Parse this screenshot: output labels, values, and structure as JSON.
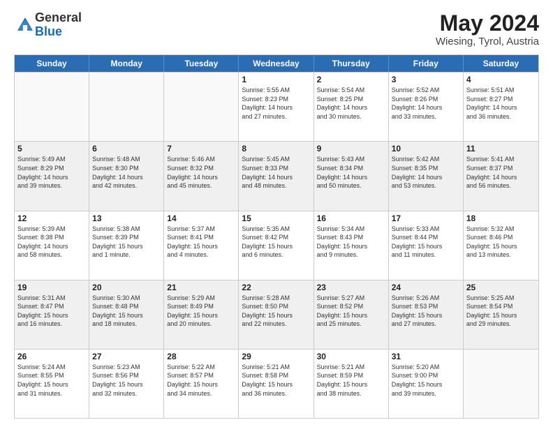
{
  "header": {
    "logo": {
      "line1": "General",
      "line2": "Blue"
    },
    "month": "May 2024",
    "location": "Wiesing, Tyrol, Austria"
  },
  "calendar": {
    "days": [
      "Sunday",
      "Monday",
      "Tuesday",
      "Wednesday",
      "Thursday",
      "Friday",
      "Saturday"
    ],
    "rows": [
      [
        {
          "day": "",
          "info": ""
        },
        {
          "day": "",
          "info": ""
        },
        {
          "day": "",
          "info": ""
        },
        {
          "day": "1",
          "info": "Sunrise: 5:55 AM\nSunset: 8:23 PM\nDaylight: 14 hours\nand 27 minutes."
        },
        {
          "day": "2",
          "info": "Sunrise: 5:54 AM\nSunset: 8:25 PM\nDaylight: 14 hours\nand 30 minutes."
        },
        {
          "day": "3",
          "info": "Sunrise: 5:52 AM\nSunset: 8:26 PM\nDaylight: 14 hours\nand 33 minutes."
        },
        {
          "day": "4",
          "info": "Sunrise: 5:51 AM\nSunset: 8:27 PM\nDaylight: 14 hours\nand 36 minutes."
        }
      ],
      [
        {
          "day": "5",
          "info": "Sunrise: 5:49 AM\nSunset: 8:29 PM\nDaylight: 14 hours\nand 39 minutes."
        },
        {
          "day": "6",
          "info": "Sunrise: 5:48 AM\nSunset: 8:30 PM\nDaylight: 14 hours\nand 42 minutes."
        },
        {
          "day": "7",
          "info": "Sunrise: 5:46 AM\nSunset: 8:32 PM\nDaylight: 14 hours\nand 45 minutes."
        },
        {
          "day": "8",
          "info": "Sunrise: 5:45 AM\nSunset: 8:33 PM\nDaylight: 14 hours\nand 48 minutes."
        },
        {
          "day": "9",
          "info": "Sunrise: 5:43 AM\nSunset: 8:34 PM\nDaylight: 14 hours\nand 50 minutes."
        },
        {
          "day": "10",
          "info": "Sunrise: 5:42 AM\nSunset: 8:35 PM\nDaylight: 14 hours\nand 53 minutes."
        },
        {
          "day": "11",
          "info": "Sunrise: 5:41 AM\nSunset: 8:37 PM\nDaylight: 14 hours\nand 56 minutes."
        }
      ],
      [
        {
          "day": "12",
          "info": "Sunrise: 5:39 AM\nSunset: 8:38 PM\nDaylight: 14 hours\nand 58 minutes."
        },
        {
          "day": "13",
          "info": "Sunrise: 5:38 AM\nSunset: 8:39 PM\nDaylight: 15 hours\nand 1 minute."
        },
        {
          "day": "14",
          "info": "Sunrise: 5:37 AM\nSunset: 8:41 PM\nDaylight: 15 hours\nand 4 minutes."
        },
        {
          "day": "15",
          "info": "Sunrise: 5:35 AM\nSunset: 8:42 PM\nDaylight: 15 hours\nand 6 minutes."
        },
        {
          "day": "16",
          "info": "Sunrise: 5:34 AM\nSunset: 8:43 PM\nDaylight: 15 hours\nand 9 minutes."
        },
        {
          "day": "17",
          "info": "Sunrise: 5:33 AM\nSunset: 8:44 PM\nDaylight: 15 hours\nand 11 minutes."
        },
        {
          "day": "18",
          "info": "Sunrise: 5:32 AM\nSunset: 8:46 PM\nDaylight: 15 hours\nand 13 minutes."
        }
      ],
      [
        {
          "day": "19",
          "info": "Sunrise: 5:31 AM\nSunset: 8:47 PM\nDaylight: 15 hours\nand 16 minutes."
        },
        {
          "day": "20",
          "info": "Sunrise: 5:30 AM\nSunset: 8:48 PM\nDaylight: 15 hours\nand 18 minutes."
        },
        {
          "day": "21",
          "info": "Sunrise: 5:29 AM\nSunset: 8:49 PM\nDaylight: 15 hours\nand 20 minutes."
        },
        {
          "day": "22",
          "info": "Sunrise: 5:28 AM\nSunset: 8:50 PM\nDaylight: 15 hours\nand 22 minutes."
        },
        {
          "day": "23",
          "info": "Sunrise: 5:27 AM\nSunset: 8:52 PM\nDaylight: 15 hours\nand 25 minutes."
        },
        {
          "day": "24",
          "info": "Sunrise: 5:26 AM\nSunset: 8:53 PM\nDaylight: 15 hours\nand 27 minutes."
        },
        {
          "day": "25",
          "info": "Sunrise: 5:25 AM\nSunset: 8:54 PM\nDaylight: 15 hours\nand 29 minutes."
        }
      ],
      [
        {
          "day": "26",
          "info": "Sunrise: 5:24 AM\nSunset: 8:55 PM\nDaylight: 15 hours\nand 31 minutes."
        },
        {
          "day": "27",
          "info": "Sunrise: 5:23 AM\nSunset: 8:56 PM\nDaylight: 15 hours\nand 32 minutes."
        },
        {
          "day": "28",
          "info": "Sunrise: 5:22 AM\nSunset: 8:57 PM\nDaylight: 15 hours\nand 34 minutes."
        },
        {
          "day": "29",
          "info": "Sunrise: 5:21 AM\nSunset: 8:58 PM\nDaylight: 15 hours\nand 36 minutes."
        },
        {
          "day": "30",
          "info": "Sunrise: 5:21 AM\nSunset: 8:59 PM\nDaylight: 15 hours\nand 38 minutes."
        },
        {
          "day": "31",
          "info": "Sunrise: 5:20 AM\nSunset: 9:00 PM\nDaylight: 15 hours\nand 39 minutes."
        },
        {
          "day": "",
          "info": ""
        }
      ]
    ]
  }
}
